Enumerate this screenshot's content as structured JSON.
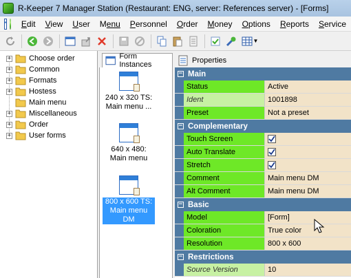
{
  "window": {
    "title": "R-Keeper 7 Manager Station (Restaurant: ENG, server: References server) - [Forms]"
  },
  "menubar": {
    "items": [
      {
        "key": "E",
        "rest": "dit"
      },
      {
        "key": "V",
        "rest": "iew"
      },
      {
        "key": "U",
        "rest": "ser"
      },
      {
        "key": "M",
        "rest": "enu",
        "underline_last": true
      },
      {
        "key": "P",
        "rest": "ersonnel"
      },
      {
        "key": "O",
        "rest": "rder"
      },
      {
        "key": "M",
        "rest": "oney"
      },
      {
        "key": "O",
        "rest": "ptions"
      },
      {
        "key": "R",
        "rest": "eports"
      },
      {
        "key": "S",
        "rest": "ervice"
      }
    ]
  },
  "tree": {
    "items": [
      {
        "label": "Choose order",
        "expandable": true
      },
      {
        "label": "Common",
        "expandable": true
      },
      {
        "label": "Formats",
        "expandable": true
      },
      {
        "label": "Hostess",
        "expandable": true
      },
      {
        "label": "Main menu",
        "expandable": false
      },
      {
        "label": "Miscellaneous",
        "expandable": true
      },
      {
        "label": "Order",
        "expandable": true
      },
      {
        "label": "User forms",
        "expandable": true
      }
    ]
  },
  "tabs": {
    "instances": "Form Instances",
    "properties": "Properties"
  },
  "instances": [
    {
      "line1": "240 x 320 TS:",
      "line2": "Main menu ...",
      "selected": false
    },
    {
      "line1": "640 x 480:",
      "line2": "Main menu",
      "selected": false
    },
    {
      "line1": "800 x 600 TS:",
      "line2": "Main menu",
      "line3": "DM",
      "selected": true
    }
  ],
  "grid": {
    "main": {
      "title": "Main",
      "status_k": "Status",
      "status_v": "Active",
      "ident_k": "Ident",
      "ident_v": "1001898",
      "preset_k": "Preset",
      "preset_v": "Not a preset"
    },
    "complementary": {
      "title": "Complementary",
      "touch_k": "Touch Screen",
      "auto_k": "Auto Translate",
      "stretch_k": "Stretch",
      "comment_k": "Comment",
      "comment_v": "Main menu DM",
      "alt_k": "Alt Comment",
      "alt_v": "Main menu DM"
    },
    "basic": {
      "title": "Basic",
      "model_k": "Model",
      "model_v": "[Form]",
      "color_k": "Coloration",
      "color_v": "True color",
      "res_k": "Resolution",
      "res_v": "800 x 600"
    },
    "restrictions": {
      "title": "Restrictions",
      "src_k": "Source Version",
      "src_v": "10"
    }
  },
  "colors": {
    "category": "#4f7aa2",
    "key_bg": "#6ee827",
    "value_bg": "#f2e3c8",
    "selection": "#3399ff"
  }
}
